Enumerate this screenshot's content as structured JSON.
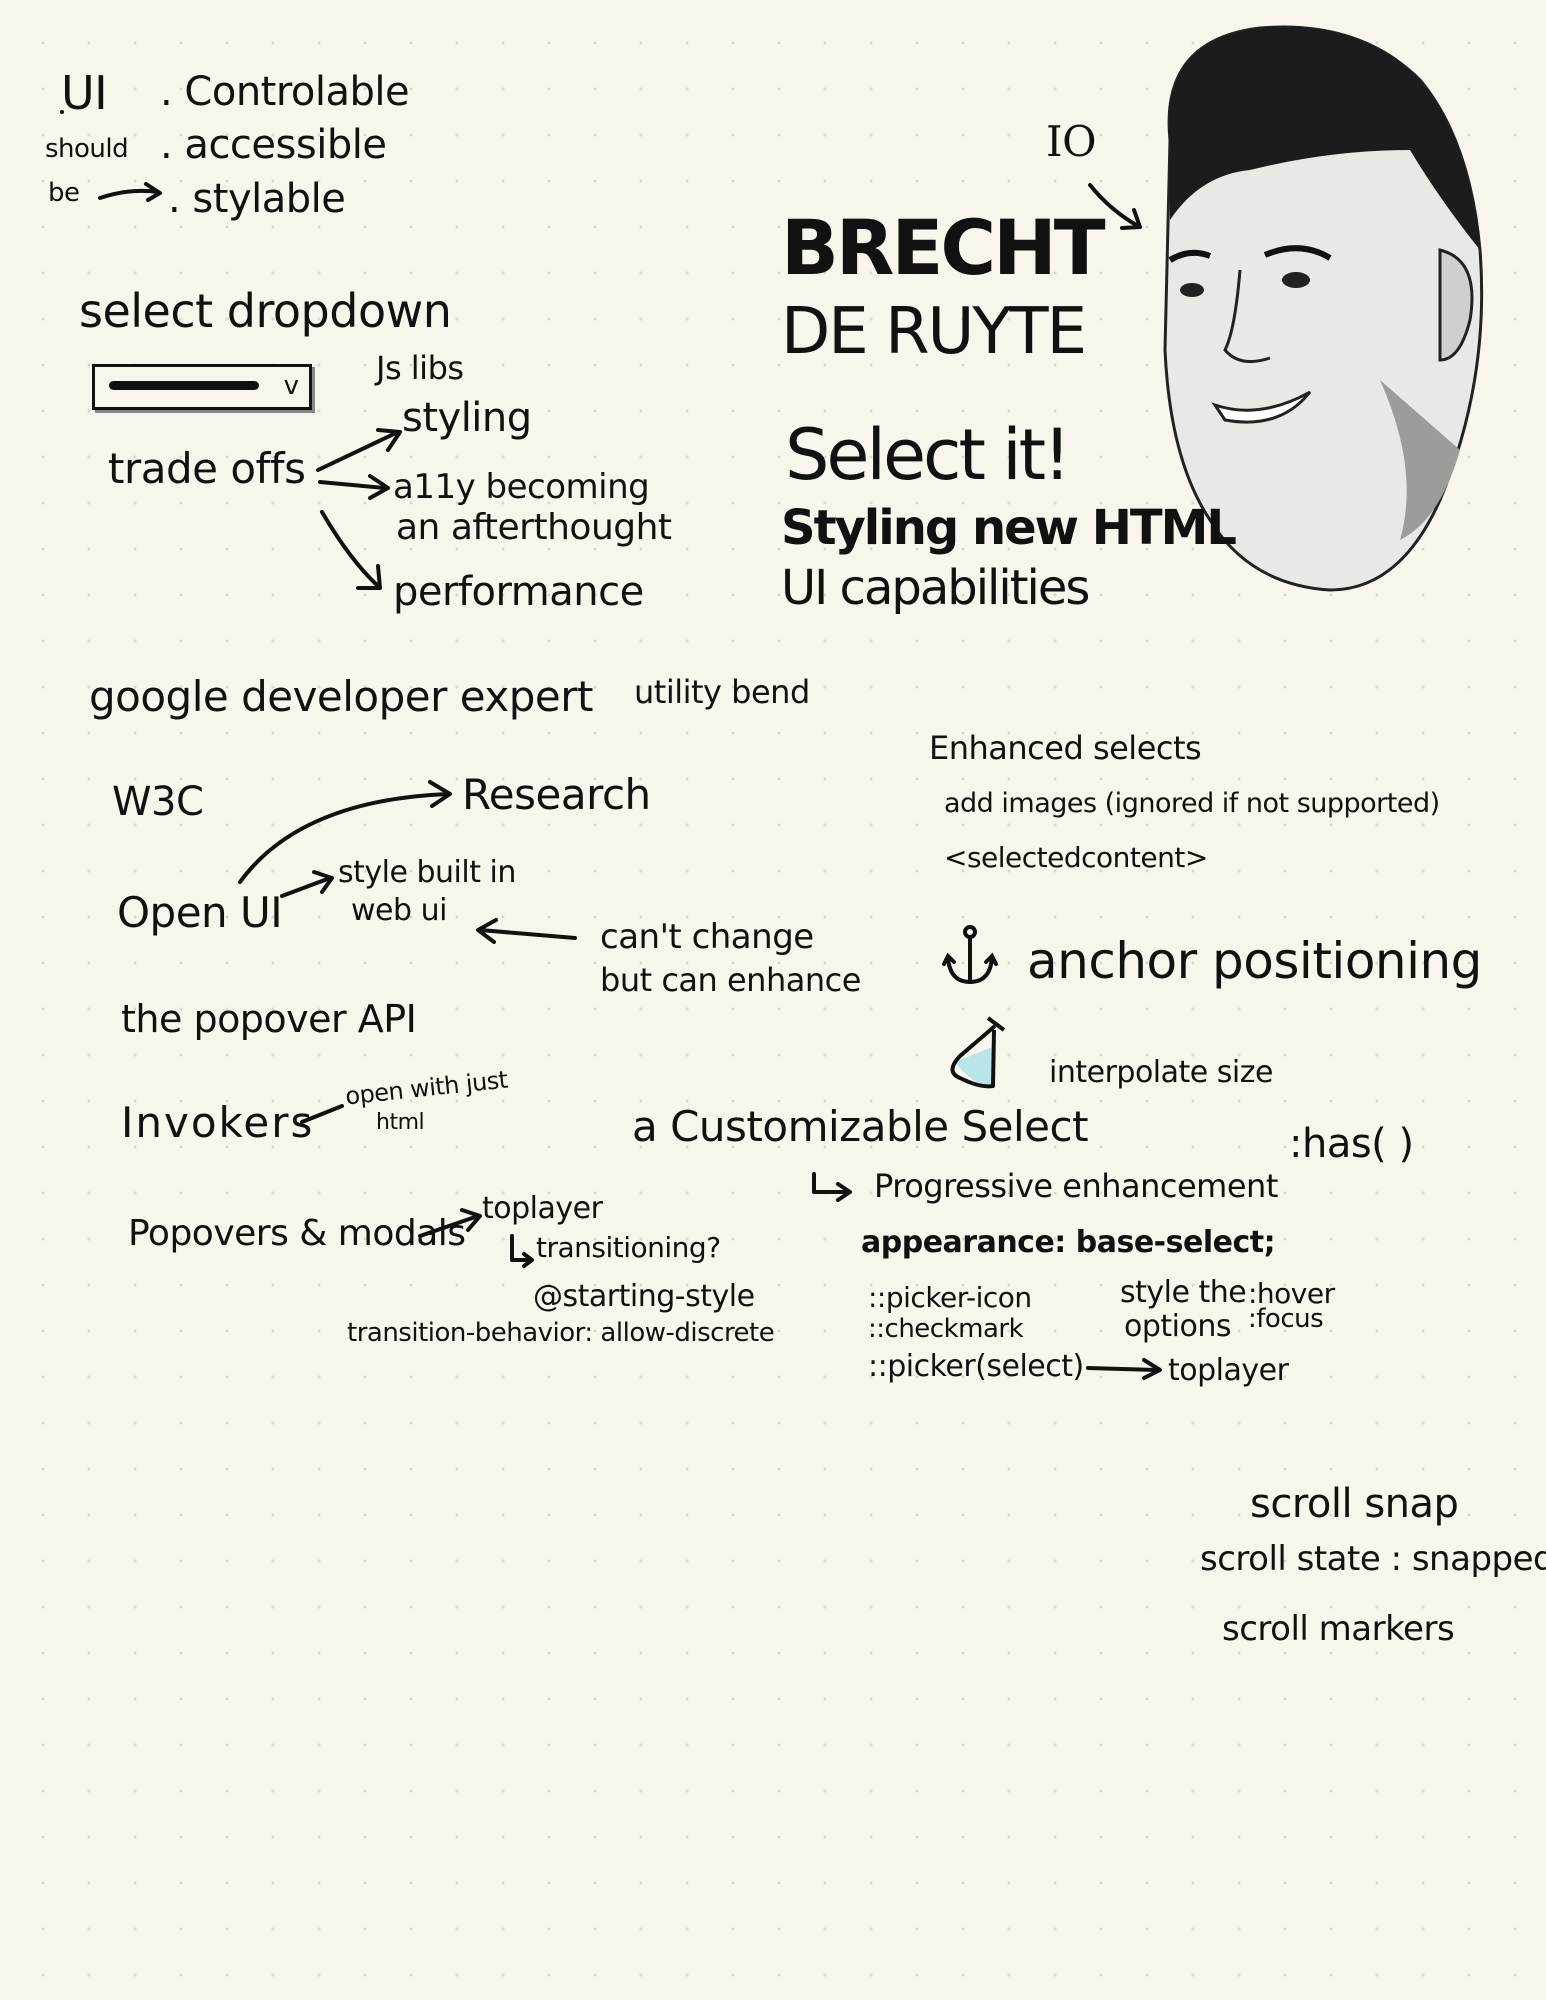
{
  "ui_principles": {
    "subject": "UI",
    "should": "should",
    "be": "be",
    "items": [
      ". Controlable",
      ". accessible",
      ". stylable"
    ]
  },
  "speaker": {
    "event": "IO",
    "first_name": "BRECHT",
    "last_name": "DE RUYTE"
  },
  "talk": {
    "title": "Select it!",
    "subtitle1": "Styling new HTML",
    "subtitle2": "UI capabilities"
  },
  "select_dropdown": {
    "heading": "select dropdown",
    "chevron": "v",
    "js_libs": "Js libs",
    "trade_offs": "trade offs",
    "styling": "styling",
    "a11y1": "a11y becoming",
    "a11y2": "an afterthought",
    "performance": "performance"
  },
  "bio": {
    "gde": "google developer expert",
    "company": "utility bend"
  },
  "enhanced": {
    "heading": "Enhanced selects",
    "images": "add images (ignored if not supported)",
    "selectedcontent": "<selectedcontent>"
  },
  "openui": {
    "w3c": "W3C",
    "research": "Research",
    "open_ui": "Open UI",
    "style1": "style built in",
    "style2": "web ui",
    "cant1": "can't change",
    "cant2": "but can enhance"
  },
  "features": {
    "anchor": "anchor positioning",
    "interpolate": "interpolate size",
    "popover": "the popover API",
    "invokers": "Invokers",
    "open1": "open with just",
    "open2": "html",
    "has": ":has( )"
  },
  "popovers": {
    "label": "Popovers & modals",
    "toplayer": "toplayer",
    "transitioning": "transitioning?",
    "starting": "@starting-style",
    "behavior": "transition-behavior: allow-discrete"
  },
  "custom_select": {
    "title": "a Customizable Select",
    "progressive": "Progressive enhancement",
    "appearance": "appearance: base-select;",
    "picker_icon": "::picker-icon",
    "checkmark": "::checkmark",
    "picker": "::picker(select)",
    "toplayer": "toplayer",
    "style1": "style the",
    "style2": "options",
    "hover": ":hover",
    "focus": ":focus"
  },
  "scroll": {
    "snap": "scroll snap",
    "state": "scroll state : snapped",
    "markers": "scroll markers"
  },
  "colors": {
    "ink": "#111111",
    "paper": "#f8f6ec",
    "flask": "#b8e4ea"
  }
}
